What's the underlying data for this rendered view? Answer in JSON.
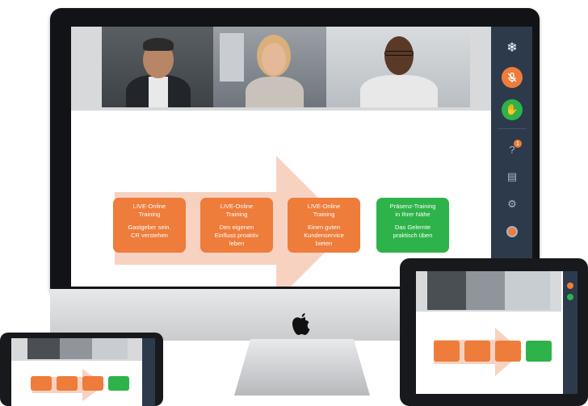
{
  "slide": {
    "steps": [
      {
        "title": "LIVE-Online\nTraining",
        "text": "Gastgeber sein.\nCR verstehen",
        "color": "#ee7c3a"
      },
      {
        "title": "LIVE-Online\nTraining",
        "text": "Den eigenen\nEinfluss proaktiv\nleben",
        "color": "#ee7c3a"
      },
      {
        "title": "LIVE-Online\nTraining",
        "text": "Einen guten\nKundenservice\nbieten",
        "color": "#ee7c3a"
      },
      {
        "title": "Präsenz-Training\nin Ihrer Nähe",
        "text": "Das Gelernte\npraktisch üben",
        "color": "#2db349"
      }
    ]
  },
  "sidebar": {
    "question_badge": "1",
    "icons": [
      "snowflake-icon",
      "mic-muted-icon",
      "raise-hand-icon",
      "question-icon",
      "notes-icon",
      "settings-icon",
      "record-icon"
    ]
  },
  "colors": {
    "accent_orange": "#ee7c3a",
    "accent_green": "#2db349",
    "sidebar_bg": "#2d3a4c",
    "arrow": "#f7d2c0"
  }
}
